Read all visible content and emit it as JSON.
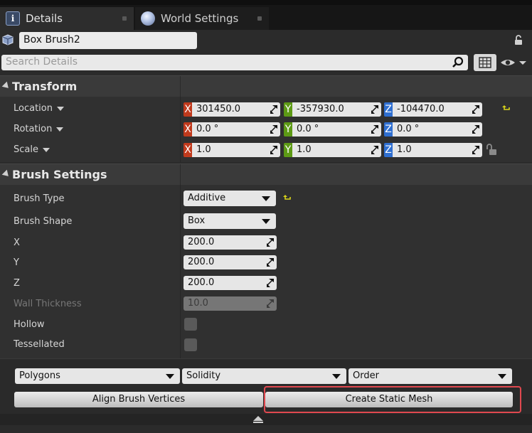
{
  "tabs": [
    {
      "label": "Details",
      "icon": "details-icon"
    },
    {
      "label": "World Settings",
      "icon": "globe-icon"
    }
  ],
  "actor_name": "Box Brush2",
  "search": {
    "placeholder": "Search Details"
  },
  "transform": {
    "label": "Transform",
    "location": {
      "label": "Location",
      "x": "301450.0",
      "y": "-357930.0",
      "z": "-104470.0"
    },
    "rotation": {
      "label": "Rotation",
      "x": "0.0 °",
      "y": "0.0 °",
      "z": "0.0 °"
    },
    "scale": {
      "label": "Scale",
      "x": "1.0",
      "y": "1.0",
      "z": "1.0"
    },
    "axis_letters": {
      "x": "X",
      "y": "Y",
      "z": "Z"
    }
  },
  "brush_settings": {
    "label": "Brush Settings",
    "brush_type": {
      "label": "Brush Type",
      "value": "Additive"
    },
    "brush_shape": {
      "label": "Brush Shape",
      "value": "Box"
    },
    "x": {
      "label": "X",
      "value": "200.0"
    },
    "y": {
      "label": "Y",
      "value": "200.0"
    },
    "z": {
      "label": "Z",
      "value": "200.0"
    },
    "wall_thickness": {
      "label": "Wall Thickness",
      "value": "10.0"
    },
    "hollow": {
      "label": "Hollow",
      "checked": false
    },
    "tessellated": {
      "label": "Tessellated",
      "checked": false
    }
  },
  "bottom": {
    "polygons": "Polygons",
    "solidity": "Solidity",
    "order": "Order",
    "align_button": "Align Brush Vertices",
    "create_button": "Create Static Mesh"
  },
  "colors": {
    "axis_x": "#c03a1d",
    "axis_y": "#5d9a15",
    "axis_z": "#2f6fd1",
    "highlight": "#e0484f",
    "reset_arrow": "#d8d21a"
  }
}
